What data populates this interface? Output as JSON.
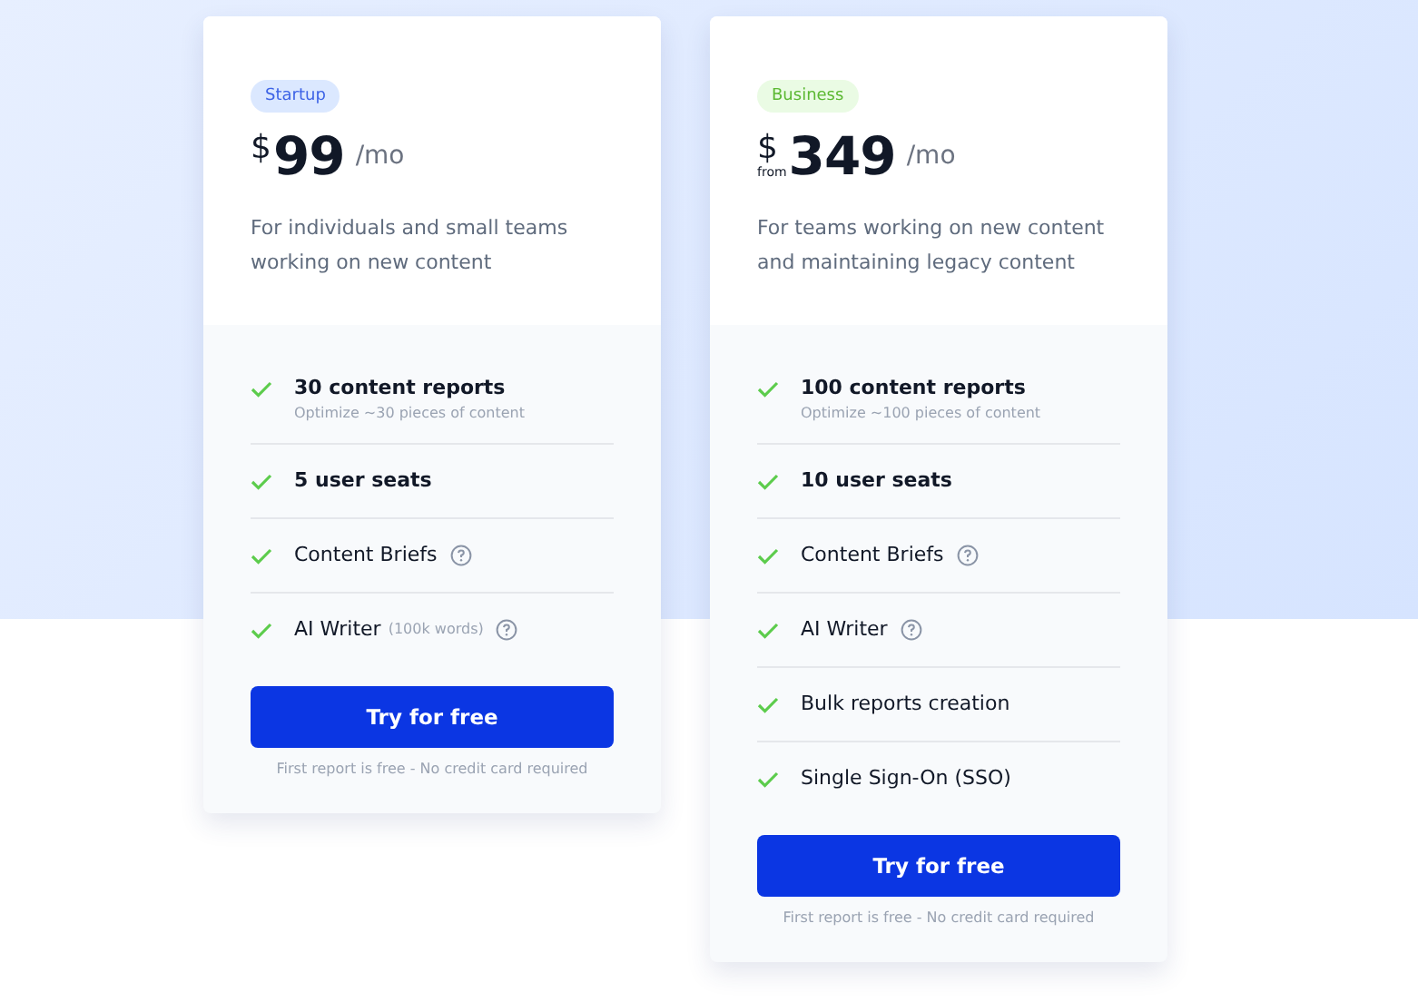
{
  "plans": [
    {
      "badge": {
        "label": "Startup",
        "color": "#dbe8ff"
      },
      "currency": "$",
      "price": "99",
      "period": "/mo",
      "description": "For individuals and small teams working on new content",
      "features": [
        {
          "kind": "strong",
          "text": "30 content reports",
          "sub": "Optimize ~30 pieces of content",
          "help": false
        },
        {
          "kind": "strong",
          "text": "5 user seats",
          "help": false
        },
        {
          "kind": "plain",
          "text": "Content Briefs",
          "help": true
        },
        {
          "kind": "plain",
          "text": "AI Writer",
          "note": "(100k words)",
          "help": true
        }
      ],
      "button": "Try for free",
      "footnote": "First report is free - No credit card required"
    },
    {
      "badge": {
        "label": "Business",
        "color": "#eafbe4"
      },
      "currency": "$",
      "prefix": "from",
      "price": "349",
      "period": "/mo",
      "description": "For teams working on new content and maintaining legacy content",
      "features": [
        {
          "kind": "strong",
          "text": "100 content reports",
          "sub": "Optimize ~100 pieces of content",
          "help": false
        },
        {
          "kind": "strong",
          "text": "10 user seats",
          "help": false
        },
        {
          "kind": "plain",
          "text": "Content Briefs",
          "help": true
        },
        {
          "kind": "plain",
          "text": "AI Writer",
          "help": true
        },
        {
          "kind": "plain",
          "text": "Bulk reports creation",
          "help": false
        },
        {
          "kind": "plain",
          "text": "Single Sign-On (SSO)",
          "help": false
        }
      ],
      "button": "Try for free",
      "footnote": "First report is free - No credit card required"
    }
  ]
}
